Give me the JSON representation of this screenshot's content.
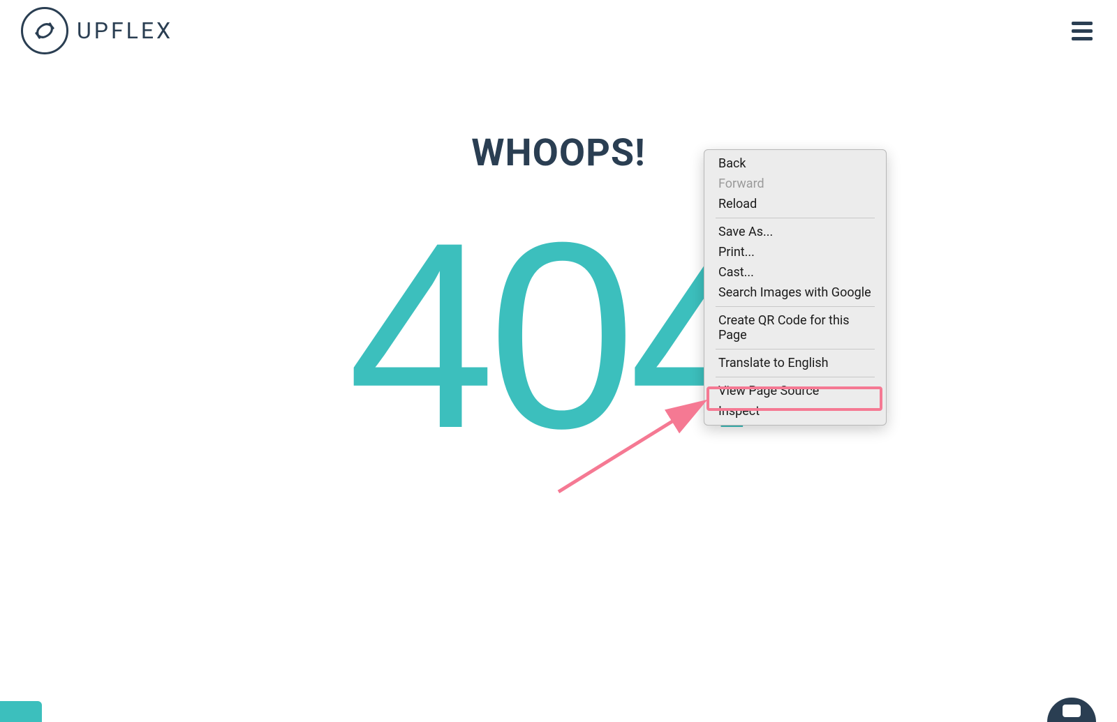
{
  "header": {
    "brand_name": "UPFLEX"
  },
  "page": {
    "heading": "WHOOPS!",
    "error_code": "404"
  },
  "context_menu": {
    "items": [
      {
        "label": "Back",
        "disabled": false
      },
      {
        "label": "Forward",
        "disabled": true
      },
      {
        "label": "Reload",
        "disabled": false
      }
    ],
    "group2": [
      {
        "label": "Save As..."
      },
      {
        "label": "Print..."
      },
      {
        "label": "Cast..."
      },
      {
        "label": "Search Images with Google"
      }
    ],
    "group3": [
      {
        "label": "Create QR Code for this Page"
      }
    ],
    "group4": [
      {
        "label": "Translate to English"
      }
    ],
    "group5": [
      {
        "label": "View Page Source"
      },
      {
        "label": "Inspect"
      }
    ]
  },
  "annotation": {
    "highlighted_item": "Inspect",
    "highlight_color": "#f57993"
  }
}
